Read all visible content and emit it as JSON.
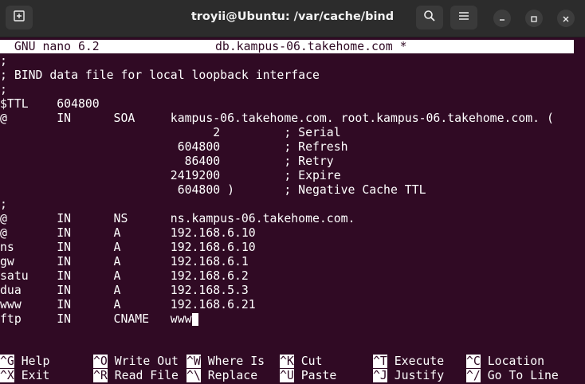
{
  "window": {
    "title": "troyii@Ubuntu: /var/cache/bind",
    "icons": [
      "new-tab-icon",
      "search-icon",
      "hamburger-menu-icon",
      "minimize-icon",
      "maximize-icon",
      "close-icon"
    ]
  },
  "nano": {
    "version": "  GNU nano 6.2",
    "filename": "db.kampus-06.takehome.com *"
  },
  "editor": {
    "lines": [
      ";",
      "; BIND data file for local loopback interface",
      ";",
      "$TTL    604800",
      "@       IN      SOA     kampus-06.takehome.com. root.kampus-06.takehome.com. (",
      "                              2         ; Serial",
      "                         604800         ; Refresh",
      "                          86400         ; Retry",
      "                        2419200         ; Expire",
      "                         604800 )       ; Negative Cache TTL",
      ";",
      "@       IN      NS      ns.kampus-06.takehome.com.",
      "@       IN      A       192.168.6.10",
      "ns      IN      A       192.168.6.10",
      "gw      IN      A       192.168.6.1",
      "satu    IN      A       192.168.6.2",
      "dua     IN      A       192.168.5.3",
      "www     IN      A       192.168.6.21",
      "ftp     IN      CNAME   www"
    ]
  },
  "shortcuts": {
    "row1": [
      {
        "key": "^G",
        "label": "Help"
      },
      {
        "key": "^O",
        "label": "Write Out"
      },
      {
        "key": "^W",
        "label": "Where Is"
      },
      {
        "key": "^K",
        "label": "Cut"
      },
      {
        "key": "^T",
        "label": "Execute"
      },
      {
        "key": "^C",
        "label": "Location"
      }
    ],
    "row2": [
      {
        "key": "^X",
        "label": "Exit"
      },
      {
        "key": "^R",
        "label": "Read File"
      },
      {
        "key": "^\\",
        "label": "Replace"
      },
      {
        "key": "^U",
        "label": "Paste"
      },
      {
        "key": "^J",
        "label": "Justify"
      },
      {
        "key": "^/",
        "label": "Go To Line"
      }
    ]
  }
}
